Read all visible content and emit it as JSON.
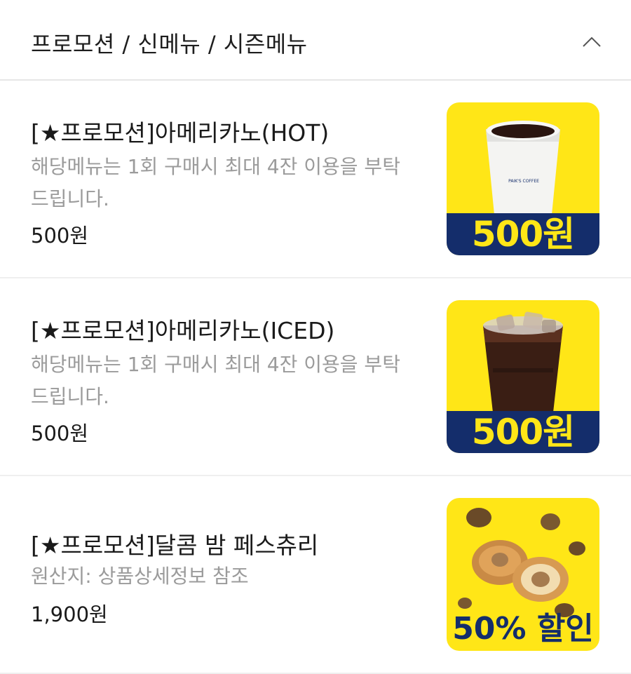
{
  "header": {
    "title": "프로모션 / 신메뉴 / 시즌메뉴",
    "collapse_icon": "chevron-up-icon"
  },
  "colors": {
    "accent_yellow": "#ffe617",
    "banner_navy": "#142d6b",
    "desc_gray": "#9b9b9b"
  },
  "items": [
    {
      "name": "[★프로모션]아메리카노(HOT)",
      "description": "해당메뉴는 1회 구매시 최대 4잔 이용을 부탁드립니다.",
      "price": "500원",
      "image": {
        "subject": "hot-americano-cup",
        "cup_label": "PAIK'S COFFEE",
        "banner": "500원"
      }
    },
    {
      "name": "[★프로모션]아메리카노(ICED)",
      "description": "해당메뉴는 1회 구매시 최대 4잔 이용을 부탁드립니다.",
      "price": "500원",
      "image": {
        "subject": "iced-americano-cup",
        "banner": "500원"
      }
    },
    {
      "name": "[★프로모션]달콤 밤 페스츄리",
      "description": "원산지: 상품상세정보 참조",
      "price": "1,900원",
      "image": {
        "subject": "chestnut-pastry",
        "badge": "50% 할인"
      }
    }
  ]
}
